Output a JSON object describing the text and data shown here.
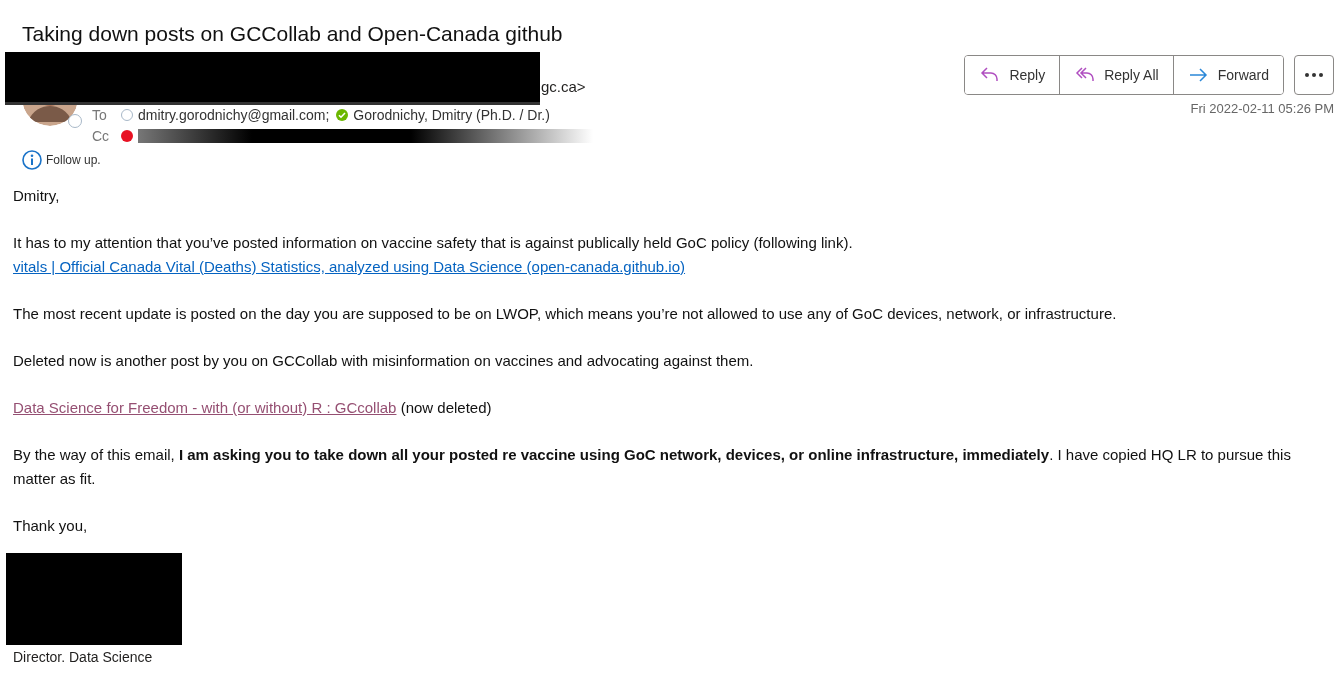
{
  "subject": "Taking down posts on GCCollab and Open-Canada github",
  "sender": {
    "visible_text": "gc.ca>"
  },
  "to": {
    "label": "To",
    "recipients": [
      {
        "name": "dmitry.gorodnichy@gmail.com;",
        "color": "#a8b8c8"
      },
      {
        "name": "Gorodnichy, Dmitry (Ph.D. / Dr.)",
        "color": "#6bb700"
      }
    ]
  },
  "cc": {
    "label": "Cc",
    "color": "#e81123"
  },
  "follow_up": "Follow up.",
  "actions": [
    {
      "label": "Reply"
    },
    {
      "label": "Reply All"
    },
    {
      "label": "Forward"
    }
  ],
  "date": "Fri 2022-02-11 05:26 PM",
  "body": [
    {
      "lines": [
        [
          {
            "text": "Dmitry,"
          }
        ]
      ]
    },
    {
      "lines": [
        [
          {
            "text": "It has to my attention that you’ve posted information on vaccine safety that is against publically held GoC policy (following link)."
          }
        ],
        [
          {
            "link": "vitals | Official Canada Vital (Deaths) Statistics, analyzed using Data Science (open-canada.github.io)",
            "visited": false
          }
        ]
      ]
    },
    {
      "lines": [
        [
          {
            "text": "The most recent update is posted on the day you are supposed to be on LWOP, which means you’re not allowed to use any of GoC devices, network, or infrastructure."
          }
        ]
      ]
    },
    {
      "lines": [
        [
          {
            "text": "Deleted now is another post by you on GCCollab with misinformation on vaccines and advocating against them."
          }
        ]
      ]
    },
    {
      "lines": [
        [
          {
            "link": "Data Science for Freedom - with (or without) R : GCcollab",
            "visited": true
          },
          {
            "text": " (now deleted)"
          }
        ]
      ]
    },
    {
      "lines": [
        [
          {
            "text": "By the way of this email, **I am asking you to take down all your posted re vaccine using GoC network, devices, or online infrastructure, immediately**. I have copied HQ LR to pursue this matter as fit."
          }
        ]
      ]
    },
    {
      "lines": [
        [
          {
            "text": "Thank you,"
          }
        ]
      ]
    }
  ],
  "signature": {
    "title": "Director. Data Science"
  }
}
